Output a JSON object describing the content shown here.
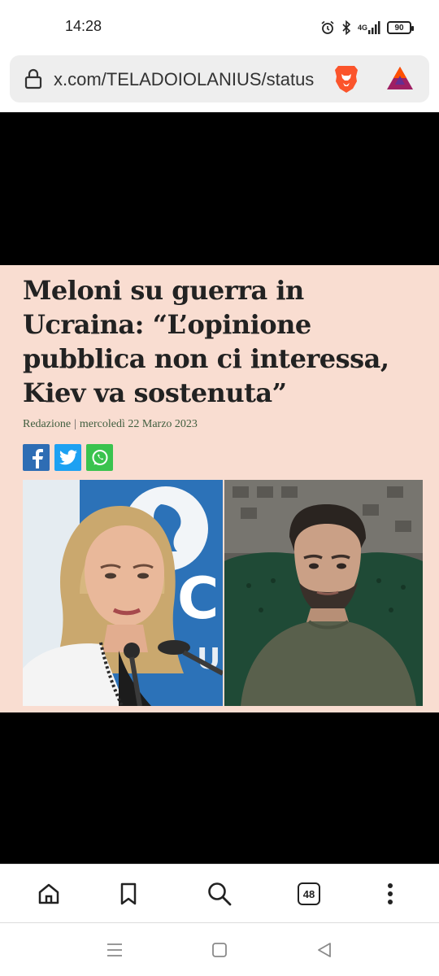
{
  "status_bar": {
    "time": "14:28",
    "network": "4G",
    "battery": "90",
    "icons": [
      "alarm-icon",
      "bluetooth-icon",
      "signal-icon",
      "battery-icon"
    ]
  },
  "browser": {
    "url": "x.com/TELADOIOLANIUS/status",
    "icons": [
      "lock-icon",
      "brave-lion-icon",
      "bat-rewards-icon"
    ]
  },
  "article": {
    "headline_lines": [
      "Meloni su guerra in",
      "Ucraina: “L’opinione",
      "pubblica non ci interessa,",
      "Kiev va sostenuta”"
    ],
    "author": "Redazione",
    "date": "mercoledì 22 Marzo 2023",
    "share_icons": [
      "facebook-icon",
      "twitter-icon",
      "whatsapp-icon"
    ]
  },
  "bottom_nav": {
    "tab_count": "48",
    "icons": [
      "home-icon",
      "bookmark-icon",
      "search-icon",
      "tabs-icon",
      "more-icon"
    ]
  },
  "system_nav": {
    "icons": [
      "recents-icon",
      "home-square-icon",
      "back-icon"
    ]
  },
  "colors": {
    "article_bg": "#f9ddd1",
    "byline": "#3f5d3e",
    "brave": "#fb542b",
    "facebook": "#2e6db4",
    "twitter": "#1da1f2",
    "whatsapp": "#3ac34e"
  }
}
